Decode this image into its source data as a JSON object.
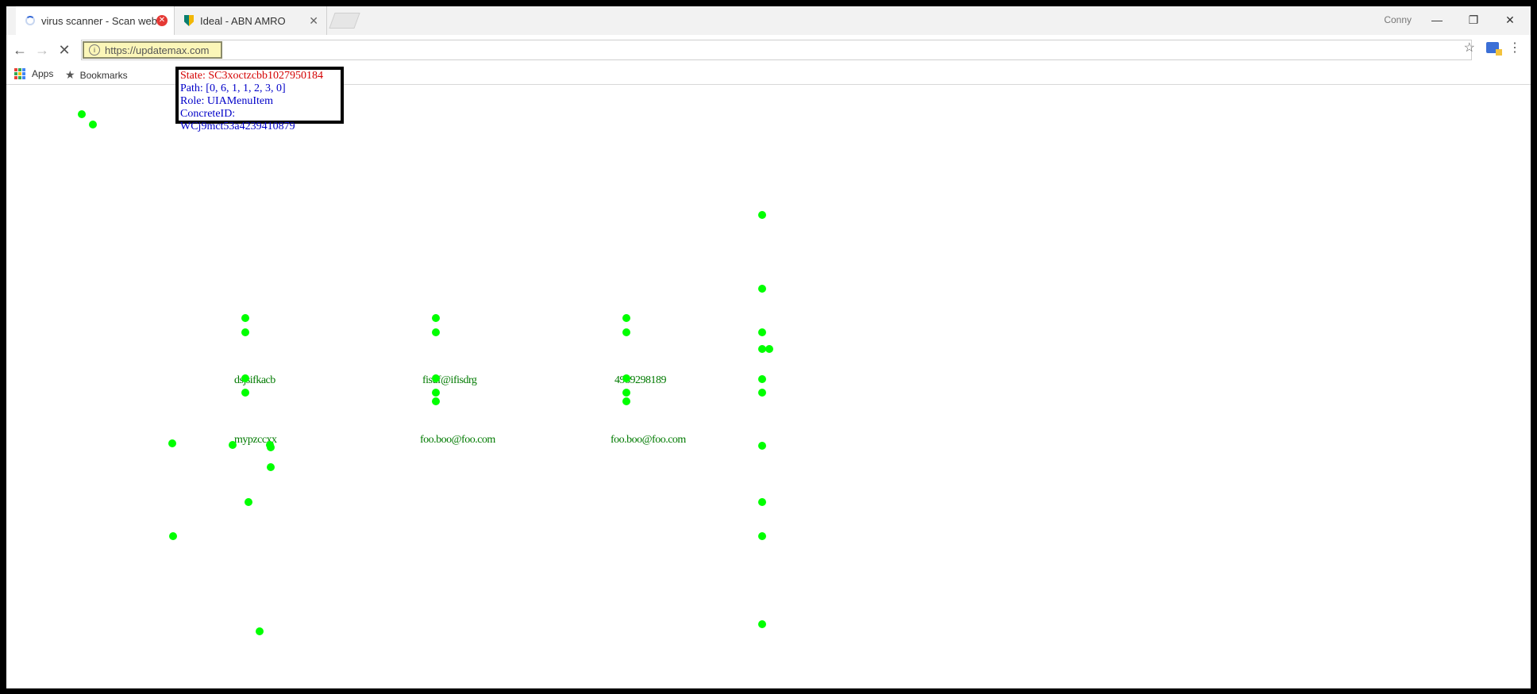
{
  "browser": {
    "tabs": [
      {
        "title": "virus scanner - Scan web",
        "state": "loading"
      },
      {
        "title": "Ideal - ABN AMRO"
      }
    ],
    "profile_name": "Conny",
    "window_controls": {
      "minimize": "—",
      "restore": "❐",
      "close": "✕"
    },
    "url": "https://updatemax.com",
    "bookmarks": [
      {
        "label": "Apps",
        "icon": "apps-grid-icon"
      },
      {
        "label": "Bookmarks",
        "icon": "star-icon"
      }
    ],
    "accent": "#3367d6"
  },
  "inspector": {
    "state": "State: SC3xoctzcbb1027950184",
    "path": "Path: [0, 6, 1, 1, 2, 3, 0]",
    "role": "Role: UIAMenuItem",
    "concrete_id": "ConcreteID: WCj9mct53a4239410879"
  },
  "form_rows": [
    {
      "col1": "dsjsifkacb",
      "col2": "fisuf@ifisdrg",
      "col3": "4989298189"
    },
    {
      "col1": "mypzccxx",
      "col2": "foo.boo@foo.com",
      "col3": "foo.boo@foo.com"
    }
  ],
  "colors": {
    "marker": "#00ff00",
    "inspector_state": "#d40000",
    "inspector_text": "#0000c8"
  }
}
